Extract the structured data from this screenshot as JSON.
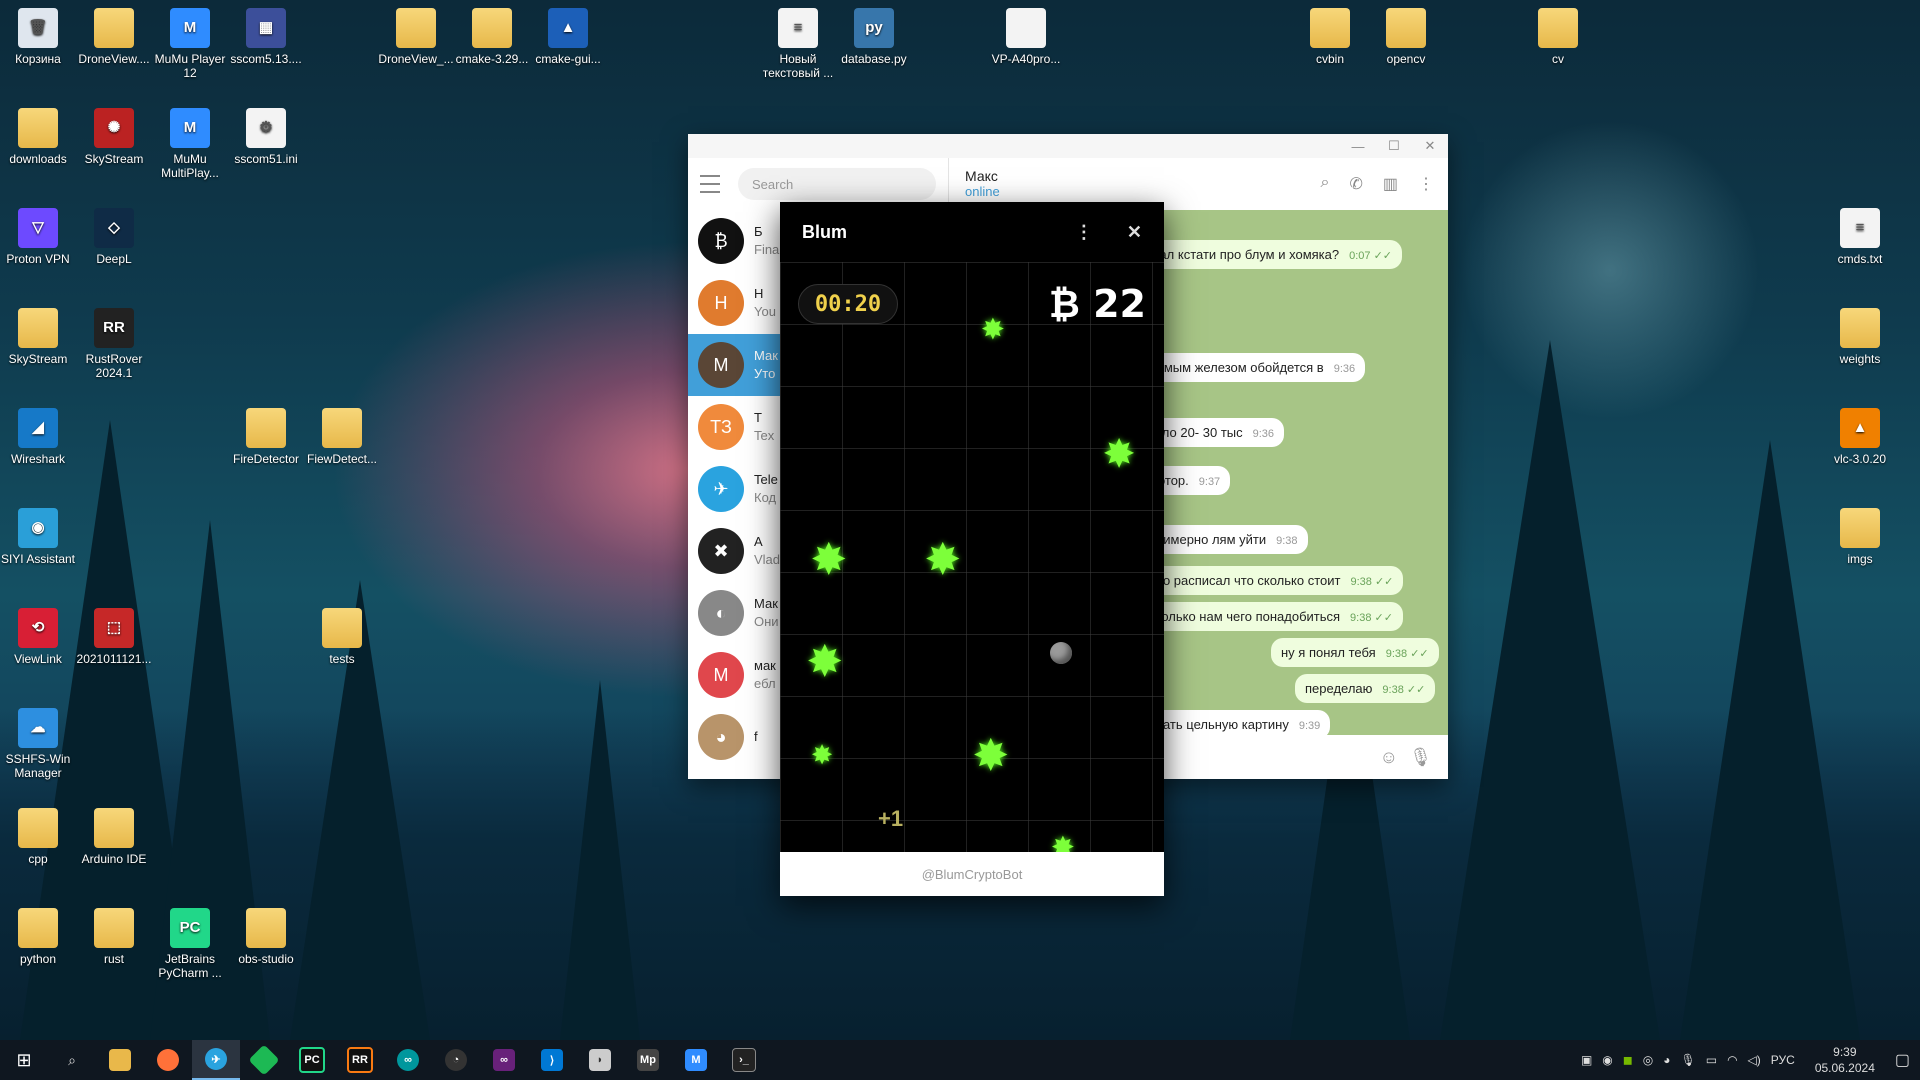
{
  "desktop_icons": [
    {
      "label": "Корзина",
      "kind": "file",
      "glyph": "🗑",
      "bg": "#dfe6ee"
    },
    {
      "label": "DroneView....",
      "kind": "folder",
      "glyph": "",
      "bg": ""
    },
    {
      "label": "MuMu Player 12",
      "kind": "app",
      "glyph": "M",
      "bg": "#2f8cff"
    },
    {
      "label": "sscom5.13....",
      "kind": "app",
      "glyph": "▦",
      "bg": "#3c4f9a"
    },
    {
      "label": "DroneView_...",
      "kind": "folder",
      "glyph": "",
      "bg": ""
    },
    {
      "label": "cmake-3.29...",
      "kind": "folder",
      "glyph": "",
      "bg": ""
    },
    {
      "label": "cmake-gui...",
      "kind": "app",
      "glyph": "▲",
      "bg": "#1c5fb8"
    },
    {
      "label": "Новый текстовый ...",
      "kind": "file",
      "glyph": "≡",
      "bg": ""
    },
    {
      "label": "database.py",
      "kind": "app",
      "glyph": "py",
      "bg": "#3776ab"
    },
    {
      "label": "VP-A40pro...",
      "kind": "file",
      "glyph": "",
      "bg": ""
    },
    {
      "label": "cvbin",
      "kind": "folder",
      "glyph": "",
      "bg": ""
    },
    {
      "label": "opencv",
      "kind": "folder",
      "glyph": "",
      "bg": ""
    },
    {
      "label": "cv",
      "kind": "folder",
      "glyph": "",
      "bg": ""
    },
    {
      "label": "downloads",
      "kind": "folder",
      "glyph": "",
      "bg": ""
    },
    {
      "label": "SkyStream",
      "kind": "app",
      "glyph": "✺",
      "bg": "#b22"
    },
    {
      "label": "MuMu MultiPlay...",
      "kind": "app",
      "glyph": "M",
      "bg": "#2f8cff"
    },
    {
      "label": "sscom51.ini",
      "kind": "file",
      "glyph": "⚙",
      "bg": ""
    },
    {
      "label": "Proton VPN",
      "kind": "app",
      "glyph": "▽",
      "bg": "#6d4aff"
    },
    {
      "label": "DeepL",
      "kind": "app",
      "glyph": "◇",
      "bg": "#0f2b46"
    },
    {
      "label": "cmds.txt",
      "kind": "file",
      "glyph": "≡",
      "bg": ""
    },
    {
      "label": "SkyStream",
      "kind": "folder",
      "glyph": "",
      "bg": ""
    },
    {
      "label": "RustRover 2024.1",
      "kind": "app",
      "glyph": "RR",
      "bg": "#222"
    },
    {
      "label": "weights",
      "kind": "folder",
      "glyph": "",
      "bg": ""
    },
    {
      "label": "Wireshark",
      "kind": "app",
      "glyph": "◢",
      "bg": "#1679c8"
    },
    {
      "label": "FireDetector",
      "kind": "folder",
      "glyph": "",
      "bg": ""
    },
    {
      "label": "FiewDetect...",
      "kind": "folder",
      "glyph": "",
      "bg": ""
    },
    {
      "label": "vlc-3.0.20",
      "kind": "app",
      "glyph": "▲",
      "bg": "#f08000"
    },
    {
      "label": "SIYI Assistant",
      "kind": "app",
      "glyph": "◉",
      "bg": "#2a9fd8"
    },
    {
      "label": "imgs",
      "kind": "folder",
      "glyph": "",
      "bg": ""
    },
    {
      "label": "ViewLink",
      "kind": "app",
      "glyph": "⟲",
      "bg": "#d81f35"
    },
    {
      "label": "2021011121...",
      "kind": "app",
      "glyph": "⬚",
      "bg": "#c62828"
    },
    {
      "label": "tests",
      "kind": "folder",
      "glyph": "",
      "bg": ""
    },
    {
      "label": "SSHFS-Win Manager",
      "kind": "app",
      "glyph": "☁",
      "bg": "#2d8fe0"
    },
    {
      "label": "cpp",
      "kind": "folder",
      "glyph": "",
      "bg": ""
    },
    {
      "label": "Arduino IDE",
      "kind": "folder",
      "glyph": "",
      "bg": ""
    },
    {
      "label": "python",
      "kind": "folder",
      "glyph": "",
      "bg": ""
    },
    {
      "label": "rust",
      "kind": "folder",
      "glyph": "",
      "bg": ""
    },
    {
      "label": "JetBrains PyCharm ...",
      "kind": "app",
      "glyph": "PC",
      "bg": "#21d789"
    },
    {
      "label": "obs-studio",
      "kind": "folder",
      "glyph": "",
      "bg": ""
    }
  ],
  "telegram": {
    "search_placeholder": "Search",
    "chats": [
      {
        "name": "Б",
        "sub": "Fina",
        "avatar_text": "₿",
        "avatar_bg": "#111"
      },
      {
        "name": "Н",
        "sub": "You",
        "avatar_text": "H",
        "avatar_bg": "#e07b2e"
      },
      {
        "name": "Мак",
        "sub": "Уто",
        "avatar_text": "M",
        "avatar_bg": "#5a4636",
        "active": true
      },
      {
        "name": "Т",
        "sub": "Tex",
        "avatar_text": "ТЗ",
        "avatar_bg": "#f08a3c"
      },
      {
        "name": "Tele",
        "sub": "Код",
        "avatar_text": "✈",
        "avatar_bg": "#2aa3df"
      },
      {
        "name": "А",
        "sub": "Vlad",
        "avatar_text": "✖",
        "avatar_bg": "#222"
      },
      {
        "name": "Мак",
        "sub": "Они",
        "avatar_text": "◐",
        "avatar_bg": "#888"
      },
      {
        "name": "мак",
        "sub": "ебл",
        "avatar_text": "М",
        "avatar_bg": "#e0474c"
      },
      {
        "name": "f",
        "sub": "",
        "avatar_text": "◕",
        "avatar_bg": "#b8946a"
      }
    ],
    "contact_name": "Макс",
    "contact_status": "online",
    "messages": [
      {
        "text": "шал кстати про блум и хомяка?",
        "time": "0:07",
        "out": true
      },
      {
        "text": "димым железом обойдется в",
        "time": "9:36",
        "out": false
      },
      {
        "text": "коло 20- 30 тыс",
        "time": "9:36",
        "out": false
      },
      {
        "text": "мотор.",
        "time": "9:37",
        "out": false
      },
      {
        "text": "примерно лям уйти",
        "time": "9:38",
        "out": false
      },
      {
        "text": "чно расписал что сколько стоит",
        "time": "9:38",
        "out": true
      },
      {
        "text": "сколько нам чего понадобиться",
        "time": "9:38",
        "out": true
      },
      {
        "text": "ну я понял тебя",
        "time": "9:38",
        "out": true
      },
      {
        "text": "переделаю",
        "time": "9:38",
        "out": true
      },
      {
        "text": "овать цельную картину",
        "time": "9:39",
        "out": false
      }
    ]
  },
  "blum": {
    "title": "Blum",
    "timer": "00:20",
    "score": "₿ 22",
    "plus": "+1",
    "footer": "@BlumCryptoBot"
  },
  "taskbar": {
    "lang": "РУС",
    "time": "9:39",
    "date": "05.06.2024"
  }
}
